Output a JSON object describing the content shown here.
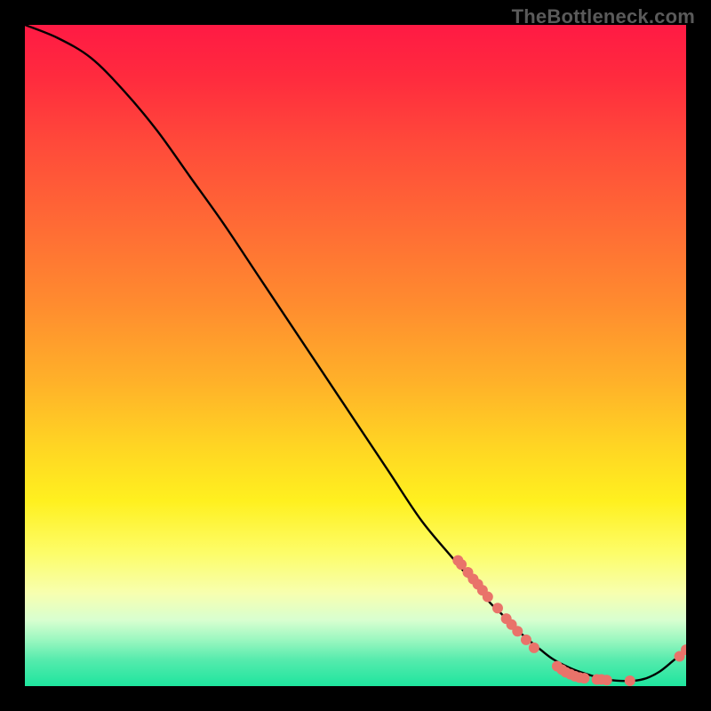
{
  "watermark": "TheBottleneck.com",
  "chart_data": {
    "type": "line",
    "title": "",
    "xlabel": "",
    "ylabel": "",
    "xlim": [
      0,
      100
    ],
    "ylim": [
      0,
      100
    ],
    "grid": false,
    "series": [
      {
        "name": "curve",
        "x": [
          0,
          5,
          10,
          15,
          20,
          25,
          30,
          35,
          40,
          45,
          50,
          55,
          60,
          65,
          70,
          72,
          75,
          78,
          80,
          83,
          86,
          88,
          90,
          92,
          94,
          96,
          98,
          100
        ],
        "values": [
          100,
          98,
          95,
          90,
          84,
          77,
          70,
          62.5,
          55,
          47.5,
          40,
          32.5,
          25,
          19,
          13,
          11,
          8,
          5.5,
          4,
          2.5,
          1.5,
          1,
          0.8,
          0.8,
          1.2,
          2.2,
          3.8,
          5.5
        ]
      }
    ],
    "markers": [
      {
        "x": 65.5,
        "y": 19.0
      },
      {
        "x": 66.0,
        "y": 18.4
      },
      {
        "x": 67.0,
        "y": 17.2
      },
      {
        "x": 67.8,
        "y": 16.2
      },
      {
        "x": 68.5,
        "y": 15.4
      },
      {
        "x": 69.2,
        "y": 14.5
      },
      {
        "x": 70.0,
        "y": 13.5
      },
      {
        "x": 71.5,
        "y": 11.8
      },
      {
        "x": 72.8,
        "y": 10.2
      },
      {
        "x": 73.6,
        "y": 9.3
      },
      {
        "x": 74.5,
        "y": 8.3
      },
      {
        "x": 75.8,
        "y": 7.0
      },
      {
        "x": 77.0,
        "y": 5.8
      },
      {
        "x": 80.5,
        "y": 3.0
      },
      {
        "x": 81.2,
        "y": 2.5
      },
      {
        "x": 81.8,
        "y": 2.1
      },
      {
        "x": 82.5,
        "y": 1.8
      },
      {
        "x": 83.2,
        "y": 1.5
      },
      {
        "x": 83.9,
        "y": 1.3
      },
      {
        "x": 84.6,
        "y": 1.2
      },
      {
        "x": 86.5,
        "y": 1.0
      },
      {
        "x": 87.2,
        "y": 1.0
      },
      {
        "x": 88.0,
        "y": 0.9
      },
      {
        "x": 91.5,
        "y": 0.8
      },
      {
        "x": 99.0,
        "y": 4.5
      },
      {
        "x": 100.0,
        "y": 5.5
      }
    ],
    "gradient_stops": [
      {
        "pos": 0.0,
        "color": "#ff1a44"
      },
      {
        "pos": 0.18,
        "color": "#ff4a3a"
      },
      {
        "pos": 0.42,
        "color": "#ff8b2f"
      },
      {
        "pos": 0.64,
        "color": "#ffd623"
      },
      {
        "pos": 0.8,
        "color": "#fdfd6a"
      },
      {
        "pos": 0.9,
        "color": "#d8ffd0"
      },
      {
        "pos": 1.0,
        "color": "#1ee59e"
      }
    ],
    "marker_style": {
      "color": "#e9736a",
      "radius": 6
    }
  }
}
